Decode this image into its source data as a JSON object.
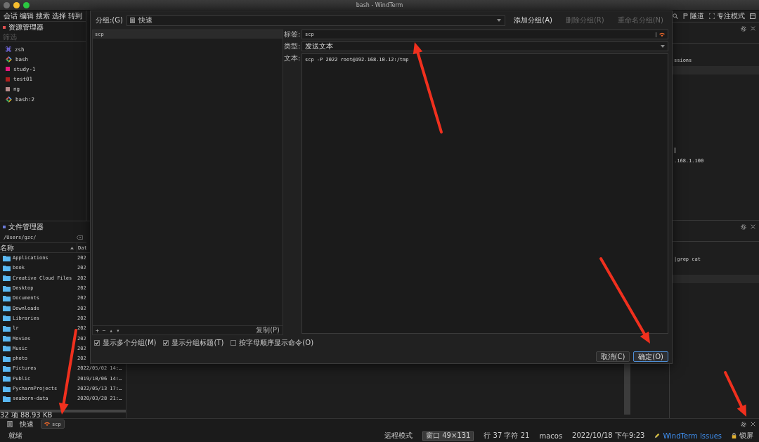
{
  "window": {
    "title": "bash - WindTerm"
  },
  "menu": [
    {
      "label": "会话"
    },
    {
      "label": "编辑"
    },
    {
      "label": "搜索"
    },
    {
      "label": "选择"
    },
    {
      "label": "转到"
    }
  ],
  "explorer": {
    "title": "资源管理器",
    "filter": {
      "placeholder": "筛选"
    },
    "sessions": [
      {
        "label": "zsh",
        "kind": "command"
      },
      {
        "label": "bash",
        "kind": "diamond"
      },
      {
        "label": "study-1",
        "kind": "square",
        "color": "#e8197d"
      },
      {
        "label": "test01",
        "kind": "square",
        "color": "#b3201f"
      },
      {
        "label": "ng",
        "kind": "square",
        "color": "#b88c8c"
      },
      {
        "label": "bash:2",
        "kind": "diamond"
      }
    ]
  },
  "file_manager": {
    "title": "文件管理器",
    "path": "/Users/gzc/",
    "columns": [
      "名称",
      "Dat"
    ],
    "rows": [
      {
        "name": "Applications",
        "date": "202"
      },
      {
        "name": "book",
        "date": "202"
      },
      {
        "name": "Creative Cloud Files",
        "date": "202"
      },
      {
        "name": "Desktop",
        "date": "202"
      },
      {
        "name": "Documents",
        "date": "202"
      },
      {
        "name": "Downloads",
        "date": "202"
      },
      {
        "name": "Libraries",
        "date": "202"
      },
      {
        "name": "lr",
        "date": "202"
      },
      {
        "name": "Movies",
        "date": "202"
      },
      {
        "name": "Music",
        "date": "202"
      },
      {
        "name": "photo",
        "date": "202"
      },
      {
        "name": "Pictures",
        "date": "2022/05/02 14:…"
      },
      {
        "name": "Public",
        "date": "2019/10/06 14:…"
      },
      {
        "name": "PycharmProjects",
        "date": "2022/05/13 17:…"
      },
      {
        "name": "seaborn-data",
        "date": "2020/03/28 21:…"
      }
    ],
    "summary": "32 项 88.93 KB"
  },
  "toolbar": [
    {
      "kind": "search"
    },
    {
      "kind": "tunnel",
      "label": "隧道"
    },
    {
      "kind": "focus",
      "label": "专注模式"
    },
    {
      "kind": "window"
    }
  ],
  "panes": [
    {
      "lines": [
        "ssions",
        ".168.1.100"
      ]
    },
    {
      "lines": [
        "|grep cat"
      ]
    }
  ],
  "bottom_tabs": {
    "group": "快速",
    "tabs": [
      {
        "label": "scp",
        "selected": true
      }
    ]
  },
  "status_bar": {
    "message": "就绪",
    "items": [
      {
        "kind": "text",
        "text": "远程模式"
      },
      {
        "kind": "boxed",
        "text": "窗口 49×131"
      },
      {
        "kind": "text",
        "text": "行 37 字符 21"
      },
      {
        "kind": "text",
        "text": "macos"
      },
      {
        "kind": "text",
        "text": "2022/10/18 下午9:23"
      },
      {
        "kind": "link",
        "text": "WindTerm Issues"
      },
      {
        "kind": "lock",
        "text": "锁屏"
      }
    ]
  },
  "dialog": {
    "group_label": "分组:(G)",
    "group": "快速",
    "group_buttons": [
      {
        "label": "添加分组(A)",
        "disabled": false
      },
      {
        "label": "删除分组(R)",
        "disabled": true
      },
      {
        "label": "重命名分组(N)",
        "disabled": true
      }
    ],
    "commands": [
      {
        "label": "scp",
        "selected": true
      }
    ],
    "list_tools": [
      "+",
      "−",
      "▴",
      "▾"
    ],
    "copy_button": "复制(P)",
    "fields": [
      {
        "kind": "text",
        "label": "标签:",
        "value": "scp"
      },
      {
        "kind": "select",
        "label": "类型:",
        "value": "发送文本"
      },
      {
        "kind": "textarea",
        "label": "文本:",
        "value": "scp -P 2022 root@192.168.10.12:/tmp"
      }
    ],
    "options": [
      {
        "label": "显示多个分组(M)",
        "checked": true
      },
      {
        "label": "显示分组标题(T)",
        "checked": true
      },
      {
        "label": "按字母顺序显示命令(O)",
        "checked": false
      }
    ],
    "buttons": [
      {
        "label": "取消(C)",
        "kind": "normal"
      },
      {
        "label": "确定(O)",
        "kind": "default"
      }
    ]
  }
}
